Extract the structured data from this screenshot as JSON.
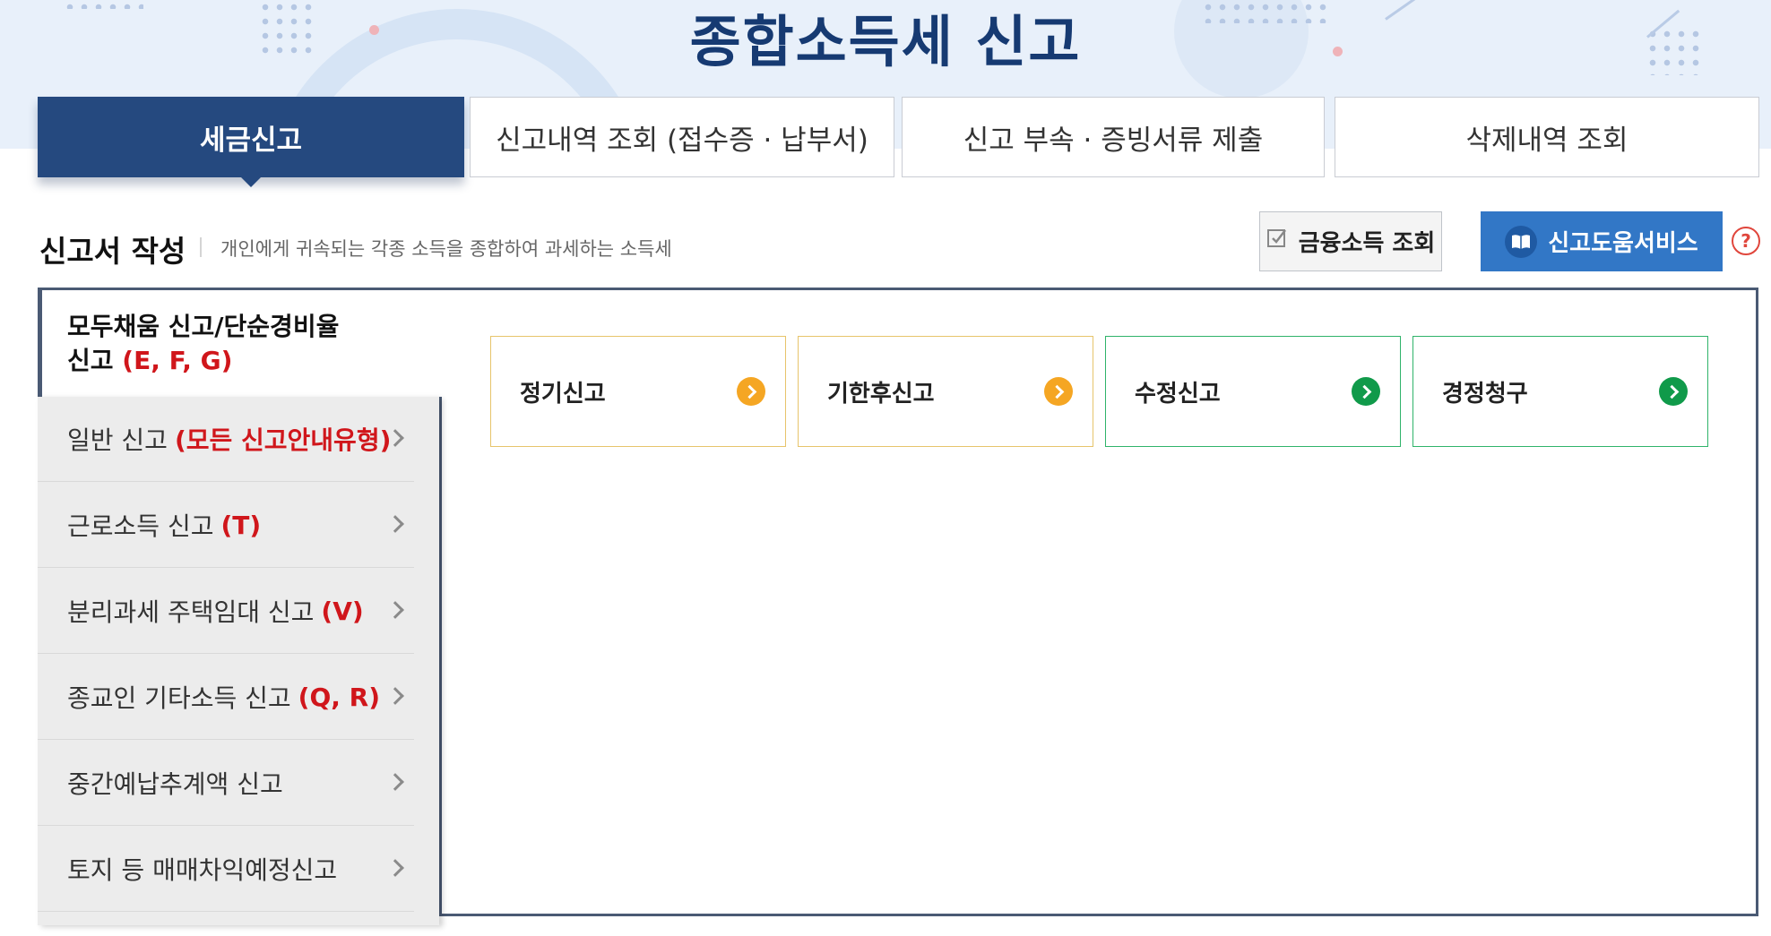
{
  "page": {
    "title": "종합소득세 신고"
  },
  "tabs": [
    {
      "label": "세금신고",
      "active": true
    },
    {
      "label": "신고내역 조회 (접수증 · 납부서)",
      "active": false
    },
    {
      "label": "신고 부속 · 증빙서류 제출",
      "active": false
    },
    {
      "label": "삭제내역 조회",
      "active": false
    }
  ],
  "section": {
    "title": "신고서 작성",
    "description": "개인에게 귀속되는 각종 소득을 종합하여 과세하는 소득세"
  },
  "actions": {
    "financial_income_label": "금융소득 조회",
    "financial_income_icon": "checkbox-edit-icon",
    "help_service_label": "신고도움서비스",
    "help_service_icon": "book-icon",
    "help_question_icon": "question-icon",
    "help_question_glyph": "?"
  },
  "sidebar": {
    "active": {
      "line1": "모두채움 신고/단순경비율",
      "line2": "신고",
      "code": "(E, F, G)"
    },
    "items": [
      {
        "label": "일반 신고",
        "code": "(모든 신고안내유형)"
      },
      {
        "label": "근로소득 신고",
        "code": "(T)"
      },
      {
        "label": "분리과세 주택임대 신고",
        "code": "(V)"
      },
      {
        "label": "종교인 기타소득 신고",
        "code": "(Q, R)"
      },
      {
        "label": "중간예납추계액 신고",
        "code": ""
      },
      {
        "label": "토지 등 매매차익예정신고",
        "code": ""
      }
    ]
  },
  "options": [
    {
      "label": "정기신고",
      "color": "orange"
    },
    {
      "label": "기한후신고",
      "color": "orange"
    },
    {
      "label": "수정신고",
      "color": "green"
    },
    {
      "label": "경정청구",
      "color": "green"
    }
  ],
  "colors": {
    "primary_navy": "#25497f",
    "help_blue": "#3277c6",
    "accent_red": "#d0161b",
    "orange": "#f5a623",
    "green": "#109a4a"
  }
}
